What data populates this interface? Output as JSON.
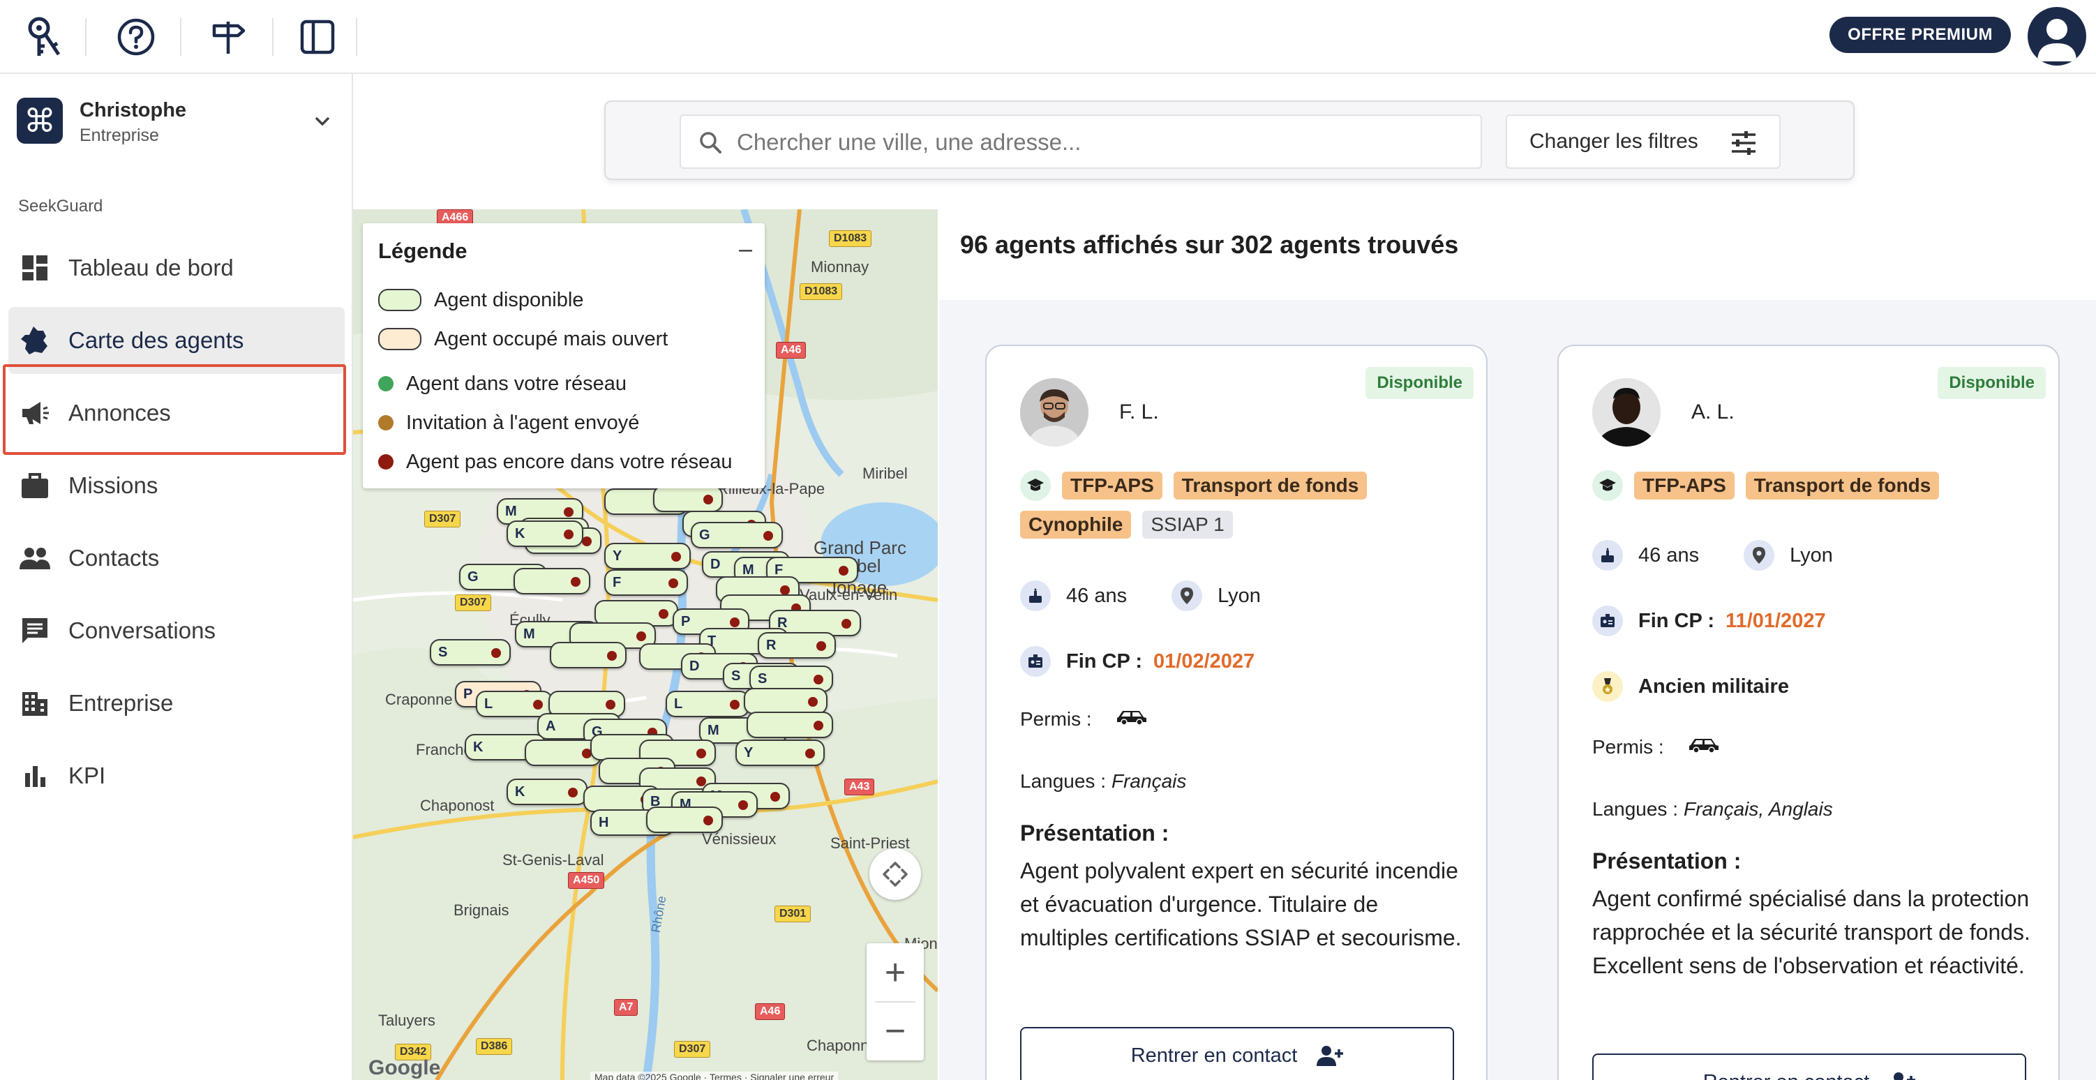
{
  "topbar": {
    "premium_label": "OFFRE PREMIUM",
    "icons": [
      "keys-logo-icon",
      "help-circle-icon",
      "signpost-icon",
      "sidebar-toggle-icon",
      "user-avatar-icon"
    ]
  },
  "workspace": {
    "name": "Christophe",
    "type": "Entreprise"
  },
  "sidebar": {
    "section_label": "SeekGuard",
    "items": [
      {
        "label": "Tableau de bord",
        "icon": "dashboard-icon"
      },
      {
        "label": "Carte des agents",
        "icon": "map-france-icon",
        "active": true
      },
      {
        "label": "Annonces",
        "icon": "megaphone-icon"
      },
      {
        "label": "Missions",
        "icon": "briefcase-icon"
      },
      {
        "label": "Contacts",
        "icon": "people-icon"
      },
      {
        "label": "Conversations",
        "icon": "chat-icon"
      },
      {
        "label": "Entreprise",
        "icon": "building-icon"
      },
      {
        "label": "KPI",
        "icon": "bar-chart-icon"
      }
    ]
  },
  "search": {
    "placeholder": "Chercher une ville, une adresse...",
    "value": "",
    "filter_label": "Changer les filtres"
  },
  "legend": {
    "title": "Légende",
    "collapse": "–",
    "items": [
      {
        "label": "Agent disponible",
        "color": "#e6f5d2"
      },
      {
        "label": "Agent occupé mais ouvert",
        "color": "#fdebd2"
      },
      {
        "label": "Agent dans votre réseau",
        "color": "#3fa55a"
      },
      {
        "label": "Invitation à l'agent envoyé",
        "color": "#b07a2a"
      },
      {
        "label": "Agent pas encore dans votre réseau",
        "color": "#8e1a10"
      }
    ]
  },
  "map": {
    "places": [
      "Mionnay",
      "Miribel",
      "Rillieux-la-Pape",
      "Grand Parc",
      "Miribel Jonage",
      "Vaulx-en-Velin",
      "Écully",
      "Craponne",
      "Francheville",
      "Chaponost",
      "St-Genis-Laval",
      "Vénissieux",
      "Saint-Priest",
      "Brignais",
      "Mions",
      "Taluyers",
      "Chaponnay",
      "Rhône"
    ],
    "roads": [
      "A466",
      "D1083",
      "D1083",
      "A46",
      "D307",
      "D307",
      "A43",
      "A450",
      "D301",
      "A7",
      "A46",
      "D342",
      "D386",
      "D307"
    ],
    "google_label": "Google",
    "attribution": "Map data ©2025 Google · Termes · Signaler une erreur"
  },
  "results": {
    "count_text": "96 agents affichés sur 302 agents trouvés",
    "cards": [
      {
        "status": "Disponible",
        "name": "F. L.",
        "certs": [
          {
            "label": "TFP-APS",
            "style": "orange"
          },
          {
            "label": "Transport de fonds",
            "style": "orange"
          },
          {
            "label": "Cynophile",
            "style": "orange"
          },
          {
            "label": "SSIAP 1",
            "style": "grey"
          }
        ],
        "age": "46 ans",
        "city": "Lyon",
        "fin_cp_label": "Fin CP :",
        "fin_cp_date": "01/02/2027",
        "extra": null,
        "permis_label": "Permis :",
        "langues_label": "Langues :",
        "langues": "Français",
        "pres_title": "Présentation :",
        "pres_text": "Agent polyvalent expert en sécurité incendie et évacuation d'urgence. Titulaire de multiples certifications SSIAP et secourisme.",
        "contact_label": "Rentrer en contact"
      },
      {
        "status": "Disponible",
        "name": "A. L.",
        "certs": [
          {
            "label": "TFP-APS",
            "style": "orange"
          },
          {
            "label": "Transport de fonds",
            "style": "orange"
          }
        ],
        "age": "46 ans",
        "city": "Lyon",
        "fin_cp_label": "Fin CP :",
        "fin_cp_date": "11/01/2027",
        "extra": "Ancien militaire",
        "permis_label": "Permis :",
        "langues_label": "Langues :",
        "langues": "Français, Anglais",
        "pres_title": "Présentation :",
        "pres_text": "Agent confirmé spécialisé dans la protection rapprochée et la sécurité transport de fonds. Excellent sens de l'observation et réactivité.",
        "contact_label": "Rentrer en contact"
      }
    ]
  }
}
